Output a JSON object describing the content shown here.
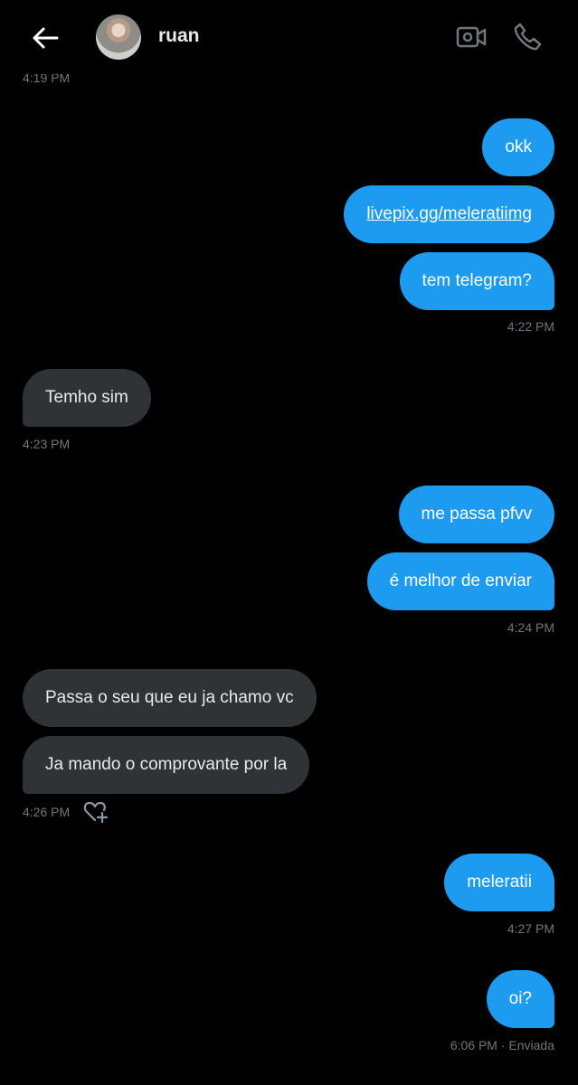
{
  "header": {
    "contact_name": "ruan",
    "icons": {
      "back": "arrow-left-icon",
      "video": "video-camera-icon",
      "call": "phone-icon"
    }
  },
  "messages": {
    "cut_time": "4:19 PM",
    "m1": "okk",
    "m2": "livepix.gg/meleratiimg",
    "m3": "tem telegram?",
    "t1": "4:22 PM",
    "m4": "Temho sim",
    "t2": "4:23 PM",
    "m5": "me passa pfvv",
    "m6": "é melhor de enviar",
    "t3": "4:24 PM",
    "m7": "Passa o seu que eu ja chamo vc",
    "m8": "Ja mando o comprovante por la",
    "t4": "4:26 PM",
    "m9": "meleratii",
    "t5": "4:27 PM",
    "m10": "oi?",
    "t6": "6:06 PM · Enviada"
  },
  "colors": {
    "background": "#000000",
    "sent_bubble": "#1d9bf0",
    "received_bubble": "#2f3336",
    "timestamp": "#71767b"
  }
}
